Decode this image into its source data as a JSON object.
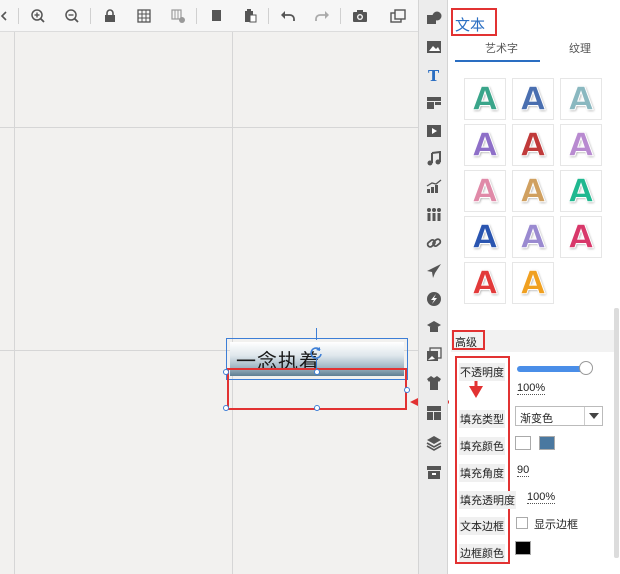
{
  "canvas": {
    "text_element": "一念执着"
  },
  "panel": {
    "title": "文本",
    "subtabs": [
      "艺术字",
      "纹理"
    ],
    "styles": [
      {
        "color": "#3aa58a"
      },
      {
        "color": "#4a6fb0"
      },
      {
        "color": "#8ab8c0"
      },
      {
        "color": "#8e6fc8"
      },
      {
        "color": "#c03a3a"
      },
      {
        "color": "#b88ad0"
      },
      {
        "color": "#e08aa8"
      },
      {
        "color": "#d0a060"
      },
      {
        "color": "#20b890"
      },
      {
        "color": "#2a55b0"
      },
      {
        "color": "#9a8ad0"
      },
      {
        "color": "#d8386a"
      },
      {
        "color": "#e23a3a"
      },
      {
        "color": "#f0a020"
      }
    ],
    "advanced": {
      "header": "高级",
      "opacity_label": "不透明度",
      "opacity_value": "100%",
      "opacity": 1.0,
      "fill_type_label": "填充类型",
      "fill_type_value": "渐变色",
      "fill_color_label": "填充颜色",
      "fill_angle_label": "填充角度",
      "fill_angle_value": "90",
      "fill_opacity_label": "填充透明度",
      "fill_opacity_value": "100%",
      "text_border_label": "文本边框",
      "show_border_label": "显示边框",
      "show_border_checked": false,
      "border_color_label": "边框颜色"
    }
  },
  "colors": {
    "accent": "#2a6ec2",
    "highlight": "#e23232",
    "fill_color_a": "#ffffff",
    "fill_color_b": "#4a78a0",
    "border_color": "#000000"
  }
}
